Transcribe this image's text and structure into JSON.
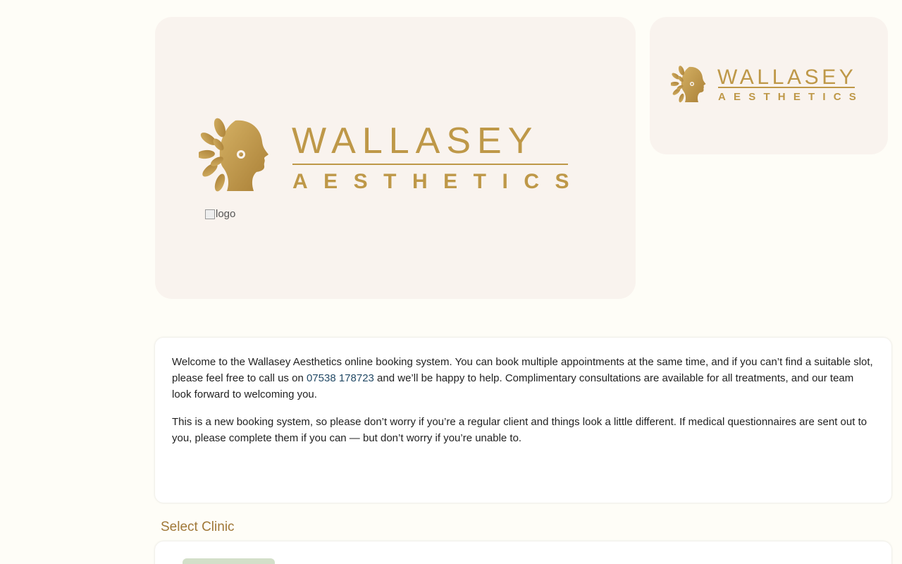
{
  "brand": {
    "name_top": "WALLASEY",
    "name_bottom": "AESTHETICS",
    "color": "#be9848",
    "emblem_icon": "leaf-face-emblem-icon"
  },
  "hero": {
    "broken_image_alt": "logo"
  },
  "welcome": {
    "p1_before": "Welcome to the Wallasey Aesthetics online booking system. You can book multiple appointments at the same time, and if you can’t find a suitable slot, please feel free to call us on ",
    "phone": "07538 178723",
    "p1_after": " and we’ll be happy to help. Complimentary consultations are available for all treatments, and our team look forward to welcoming you.",
    "p2": "This is a new booking system, so please don’t worry if you’re a regular client and things look a little different. If medical questionnaires are sent out to you, please complete them if you can — but don’t worry if you’re unable to."
  },
  "clinic_section": {
    "title": "Select Clinic"
  },
  "colors": {
    "page_bg": "#fefdf7",
    "card_bg": "#f9f3ee",
    "title": "#a07838",
    "link": "#234a66",
    "chip": "#d3dfc9"
  }
}
